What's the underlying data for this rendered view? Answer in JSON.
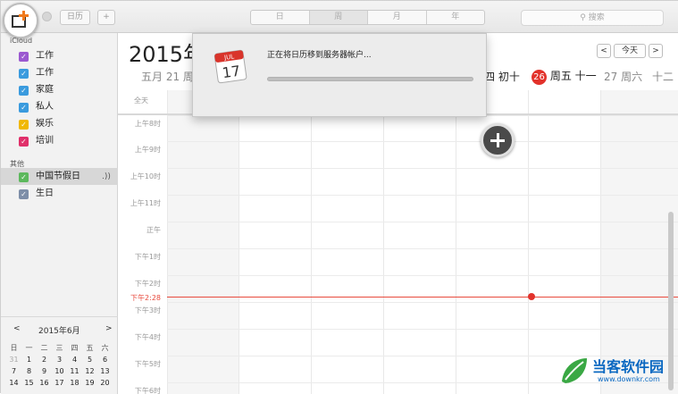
{
  "toolbar": {
    "calendars_button": "日历",
    "add_button": "+",
    "views": [
      "日",
      "周",
      "月",
      "年"
    ],
    "active_view": "周",
    "search_placeholder": "搜索"
  },
  "sidebar": {
    "icloud_group": "iCloud",
    "icloud_items": [
      {
        "label": "工作",
        "color": "#9b59d0"
      },
      {
        "label": "工作",
        "color": "#3a9bde"
      },
      {
        "label": "家庭",
        "color": "#3a9bde"
      },
      {
        "label": "私人",
        "color": "#3a9bde"
      },
      {
        "label": "娱乐",
        "color": "#f0b800"
      },
      {
        "label": "培训",
        "color": "#e0306a"
      }
    ],
    "other_group": "其他",
    "other_items": [
      {
        "label": "中国节假日",
        "color": "#5cb85c"
      },
      {
        "label": "生日",
        "color": "#7d8ea8"
      }
    ]
  },
  "mini_calendar": {
    "title": "2015年6月",
    "prev": "<",
    "next": ">",
    "weekdays": [
      "日",
      "一",
      "二",
      "三",
      "四",
      "五",
      "六"
    ],
    "rows": [
      [
        "31",
        "1",
        "2",
        "3",
        "4",
        "5",
        "6"
      ],
      [
        "7",
        "8",
        "9",
        "10",
        "11",
        "12",
        "13"
      ],
      [
        "14",
        "15",
        "16",
        "17",
        "18",
        "19",
        "20"
      ]
    ]
  },
  "main": {
    "title": "2015年",
    "today_button": "今天",
    "prev": "<",
    "next": ">",
    "day_header_left": "五月 21 周",
    "day_header_mid": "四  初十",
    "today_day": "26",
    "day_header_right": "周五 十一",
    "day_header_sat": "27 周六",
    "day_header_last": "十二",
    "allday_label": "全天",
    "hour_labels": [
      "上午8时",
      "上午9时",
      "上午10时",
      "上午11时",
      "正午",
      "下午1时",
      "下午2时",
      "下午3时",
      "下午4时",
      "下午5时",
      "下午6时"
    ],
    "now_label": "下午2:28"
  },
  "popup": {
    "icon_month": "JUL",
    "icon_day": "17",
    "message": "正在将日历移到服务器帐户...",
    "progress": 1.0
  },
  "watermark": {
    "title": "当客软件园",
    "url": "www.downkr.com"
  },
  "colors": {
    "accent_red": "#e2322b",
    "watermark_blue": "#0a68c1"
  }
}
